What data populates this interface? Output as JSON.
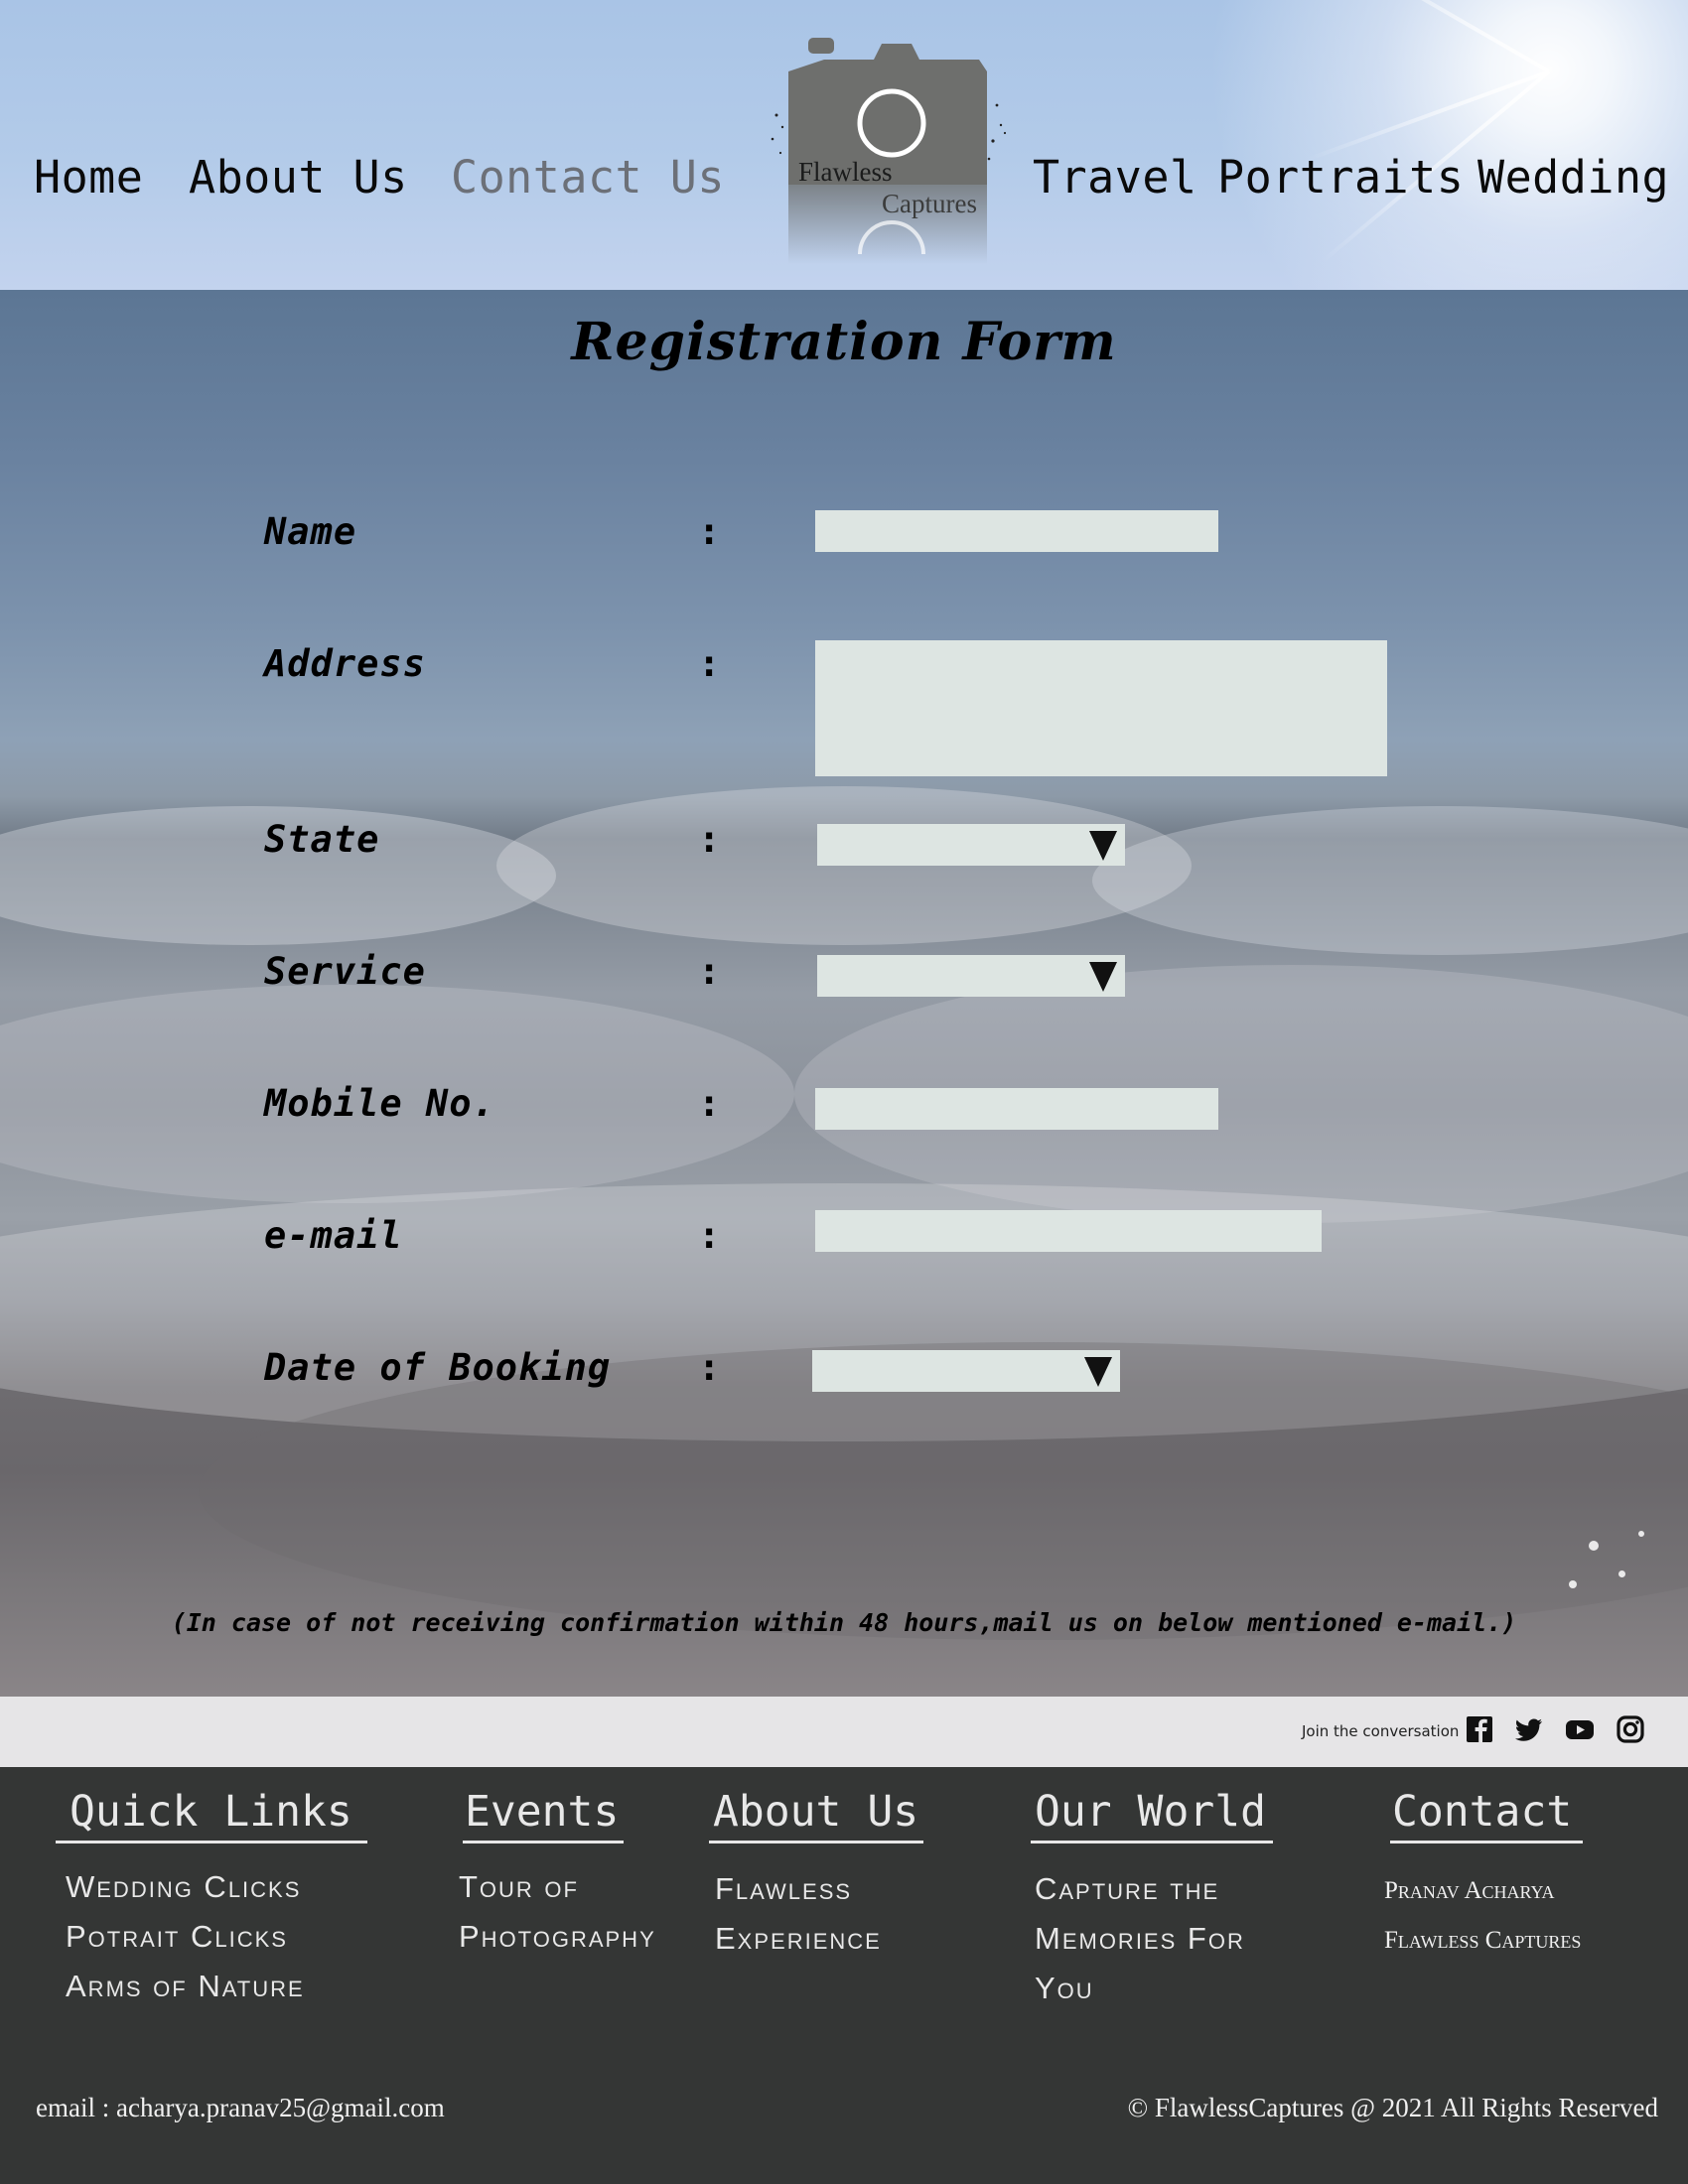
{
  "nav": {
    "home": "Home",
    "about": "About Us",
    "contact": "Contact Us",
    "travel": "Travel",
    "portraits": "Portraits",
    "wedding": "Wedding"
  },
  "logo": {
    "line1": "Flawless",
    "line2": "Captures"
  },
  "form": {
    "title": "Registration Form",
    "labels": {
      "name": "Name",
      "address": "Address",
      "state": "State",
      "service": "Service",
      "mobile": "Mobile No.",
      "email": "e-mail",
      "date": "Date of Booking"
    },
    "colon": ":",
    "values": {
      "name": "",
      "address": "",
      "state": "",
      "service": "",
      "mobile": "",
      "email": "",
      "date": ""
    },
    "note": "(In case of not receiving confirmation within 48 hours,mail us on below mentioned e-mail.)"
  },
  "social": {
    "join_text": "Join the conversation",
    "icons": [
      "facebook-icon",
      "twitter-icon",
      "youtube-icon",
      "instagram-icon"
    ]
  },
  "footer": {
    "quick_links": {
      "heading": "Quick Links",
      "items": [
        "Wedding Clicks",
        "Potrait Clicks",
        "Arms of Nature"
      ]
    },
    "events": {
      "heading": "Events",
      "items": [
        "Tour of",
        "Photography"
      ]
    },
    "about": {
      "heading": "About Us",
      "items": [
        "Flawless",
        "Experience"
      ]
    },
    "world": {
      "heading": "Our World",
      "items": [
        "Capture the",
        "Memories For",
        "You"
      ]
    },
    "contact": {
      "heading": "Contact",
      "items": [
        "Pranav Acharya",
        "Flawless Captures"
      ]
    },
    "email": "email : acharya.pranav25@gmail.com",
    "copyright": "© FlawlessCaptures @ 2021 All Rights Reserved"
  },
  "colors": {
    "nav_active": "#6c7078",
    "field_bg": "#dde5e2",
    "footer_bg": "#343635",
    "social_bar_bg": "#e6e5e7"
  }
}
